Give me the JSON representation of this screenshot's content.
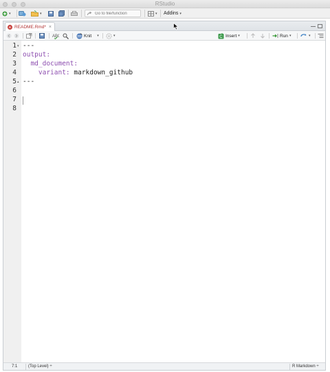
{
  "window": {
    "title": "RStudio"
  },
  "main_toolbar": {
    "goto_placeholder": "Go to file/function",
    "addins_label": "Addins"
  },
  "editor": {
    "tab_label": "README.Rmd*",
    "knit_label": "Knit",
    "insert_label": "Insert",
    "run_label": "Run",
    "lines": [
      {
        "number": "1",
        "text": "---"
      },
      {
        "number": "2",
        "text": "output:"
      },
      {
        "number": "3",
        "text": "  md_document:"
      },
      {
        "number": "4",
        "key": "    variant:",
        "value": " markdown_github"
      },
      {
        "number": "5",
        "text": "---"
      },
      {
        "number": "6",
        "text": ""
      },
      {
        "number": "7",
        "text": ""
      },
      {
        "number": "8",
        "text": ""
      }
    ]
  },
  "status_bar": {
    "position": "7:1",
    "scope": "(Top Level) ÷",
    "file_type": "R Markdown ÷"
  },
  "colors": {
    "yaml_key": "#8e4fb0",
    "gutter_bg": "#f0f0f0",
    "tab_label": "#b03030"
  },
  "icons": [
    "new-file-icon",
    "open-project-icon",
    "open-file-icon",
    "save-icon",
    "save-all-icon",
    "print-icon",
    "go-to-arrow-icon",
    "grid-icon",
    "back-arrow-icon",
    "forward-arrow-icon",
    "show-in-window-icon",
    "spellcheck-icon",
    "find-icon",
    "knit-icon",
    "settings-gear-icon",
    "insert-chunk-icon",
    "up-arrow-icon",
    "down-arrow-icon",
    "run-icon",
    "rerun-icon",
    "outline-icon",
    "minimize-icon",
    "maximize-icon"
  ]
}
